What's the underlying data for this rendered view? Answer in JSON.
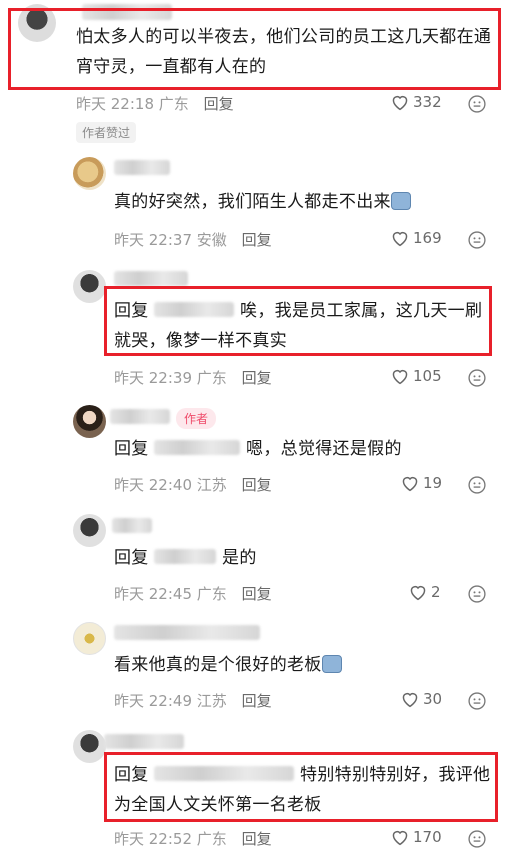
{
  "comments": [
    {
      "text": "怕太多人的可以半夜去，他们公司的员工这几天都在通宵守灵，一直都有人在的",
      "time": "昨天 22:18",
      "location": "广东",
      "reply_label": "回复",
      "likes": "332",
      "badge": "作者赞过"
    },
    {
      "text": "真的好突然，我们陌生人都走不出来",
      "time": "昨天 22:37",
      "location": "安徽",
      "reply_label": "回复",
      "likes": "169"
    },
    {
      "reply_prefix": "回复",
      "text": "唉，我是员工家属，这几天一刷就哭，像梦一样不真实",
      "time": "昨天 22:39",
      "location": "广东",
      "reply_label": "回复",
      "likes": "105"
    },
    {
      "author_tag": "作者",
      "reply_prefix": "回复",
      "text": "嗯，总觉得还是假的",
      "time": "昨天 22:40",
      "location": "江苏",
      "reply_label": "回复",
      "likes": "19"
    },
    {
      "reply_prefix": "回复",
      "text": "是的",
      "time": "昨天 22:45",
      "location": "广东",
      "reply_label": "回复",
      "likes": "2"
    },
    {
      "text": "看来他真的是个很好的老板",
      "time": "昨天 22:49",
      "location": "江苏",
      "reply_label": "回复",
      "likes": "30"
    },
    {
      "reply_prefix": "回复",
      "text": "特别特别特别好，我评他为全国人文关怀第一名老板",
      "time": "昨天 22:52",
      "location": "广东",
      "reply_label": "回复",
      "likes": "170"
    }
  ],
  "colors": {
    "highlight_border": "#e8202a",
    "meta_text": "#9a9a9a",
    "author_tag_bg": "#fde8ec",
    "author_tag_text": "#ef4b6a"
  }
}
